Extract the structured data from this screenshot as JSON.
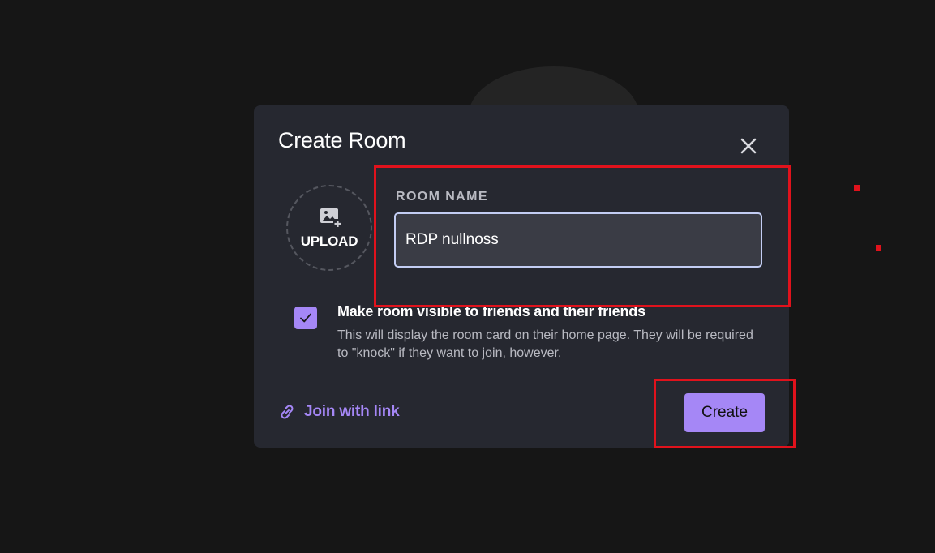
{
  "modal": {
    "title": "Create Room",
    "upload_label": "UPLOAD",
    "room_name_label": "ROOM NAME",
    "room_name_value": "RDP nullnoss",
    "visibility_checkbox": {
      "checked": true,
      "title": "Make room visible to friends and their friends",
      "description": "This will display the room card on their home page. They will be required to \"knock\" if they want to join, however."
    },
    "join_link_label": "Join with link",
    "create_label": "Create"
  },
  "colors": {
    "background": "#161616",
    "modal": "#262830",
    "accent": "#a587f6",
    "highlight": "#e0121c"
  },
  "icons": {
    "close": "close-icon",
    "upload": "image-add-icon",
    "check": "check-icon",
    "link": "link-icon"
  }
}
